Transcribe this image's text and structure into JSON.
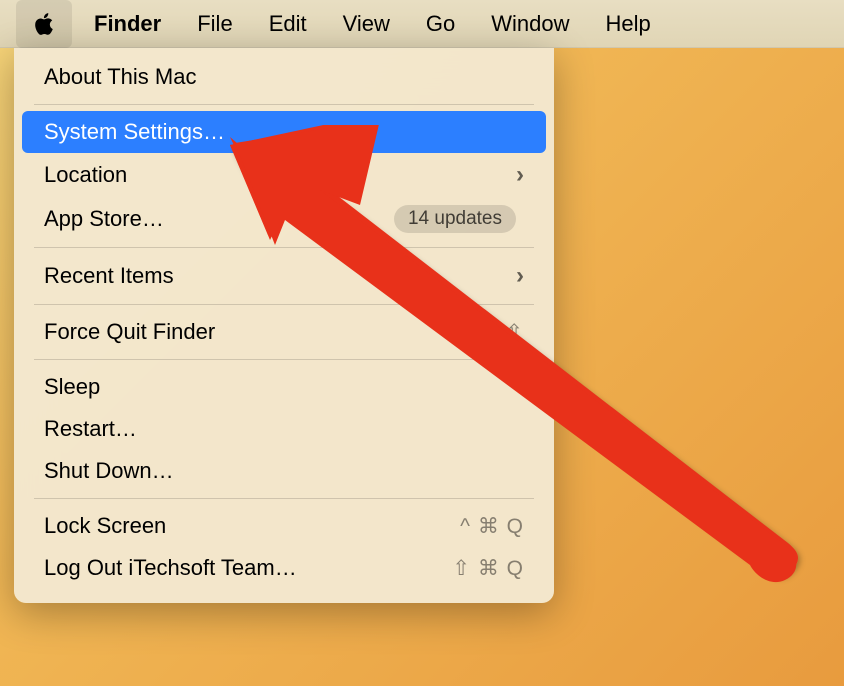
{
  "menuBar": {
    "items": [
      "Finder",
      "File",
      "Edit",
      "View",
      "Go",
      "Window",
      "Help"
    ]
  },
  "dropdown": {
    "aboutThisMac": "About This Mac",
    "systemSettings": "System Settings…",
    "location": "Location",
    "appStore": "App Store…",
    "appStoreBadge": "14 updates",
    "recentItems": "Recent Items",
    "forceQuit": "Force Quit Finder",
    "forceQuitShortcut": "⌥⇧",
    "sleep": "Sleep",
    "restart": "Restart…",
    "shutDown": "Shut Down…",
    "lockScreen": "Lock Screen",
    "lockScreenShortcut": "^ ⌘ Q",
    "logOut": "Log Out iTechsoft Team…",
    "logOutShortcut": "⇧ ⌘ Q"
  }
}
